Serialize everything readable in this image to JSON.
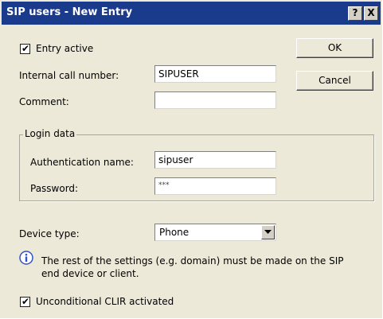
{
  "window": {
    "title": "SIP users - New Entry",
    "help_label": "?",
    "close_label": "X"
  },
  "form": {
    "entry_active": {
      "label": "Entry active",
      "checked": true
    },
    "internal_call_number": {
      "label": "Internal call number:",
      "value": "SIPUSER"
    },
    "comment": {
      "label": "Comment:",
      "value": ""
    },
    "login_data": {
      "legend": "Login data",
      "authentication_name": {
        "label": "Authentication name:",
        "value": "sipuser"
      },
      "password": {
        "label": "Password:",
        "value": "***"
      }
    },
    "device_type": {
      "label": "Device type:",
      "selected": "Phone"
    },
    "info_text_line1": "The rest of the settings (e.g. domain) must be made on the SIP",
    "info_text_line2": "end device or client.",
    "unconditional_clir": {
      "label": "Unconditional CLIR activated",
      "checked": true
    }
  },
  "buttons": {
    "ok_label": "OK",
    "cancel_label": "Cancel"
  },
  "icons": {
    "info": "info-icon",
    "checkmark": "checkmark-icon",
    "dropdown": "chevron-down-icon",
    "help": "help-icon",
    "close": "close-icon"
  },
  "colors": {
    "titlebar": "#1a3a8c",
    "dialog_background": "#ece9d8",
    "field_background": "#ffffff",
    "info_icon_fill": "#2f52c8"
  }
}
